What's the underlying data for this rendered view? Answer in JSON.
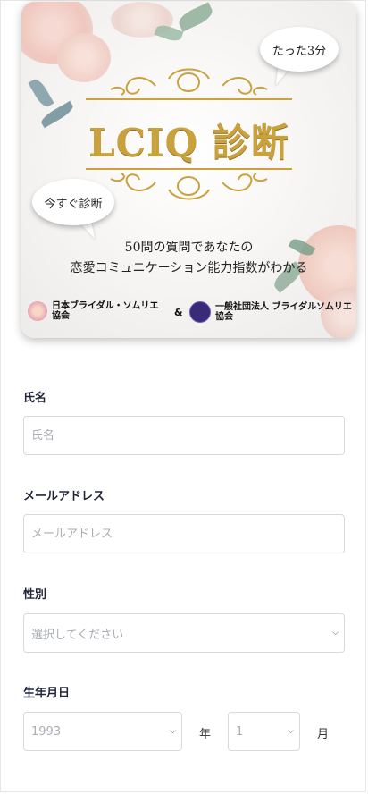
{
  "banner": {
    "bubble_top": "たった3分",
    "bubble_left": "今すぐ診断",
    "title": "LCIQ 診断",
    "subtitle_line1": "50問の質問であなたの",
    "subtitle_line2": "恋愛コミュニケーション能力指数がわかる",
    "org1_line1": "日本ブライダル・ソムリエ",
    "org1_line2": "協会",
    "ampersand": "&",
    "org2_line1": "一般社団法人 ブライダルソムリエ",
    "org2_line2": "協会"
  },
  "form": {
    "name_label": "氏名",
    "name_placeholder": "氏名",
    "email_label": "メールアドレス",
    "email_placeholder": "メールアドレス",
    "gender_label": "性別",
    "gender_selected": "選択してください",
    "birth_label": "生年月日",
    "birth_year": "1993",
    "year_unit": "年",
    "birth_month": "1",
    "month_unit": "月"
  },
  "colors": {
    "gold": "#c9a23d",
    "label": "#1f2438",
    "border": "#d6d9de",
    "placeholder": "#a9adb3"
  },
  "icons": {
    "dropdown": "chevron-down-icon"
  }
}
